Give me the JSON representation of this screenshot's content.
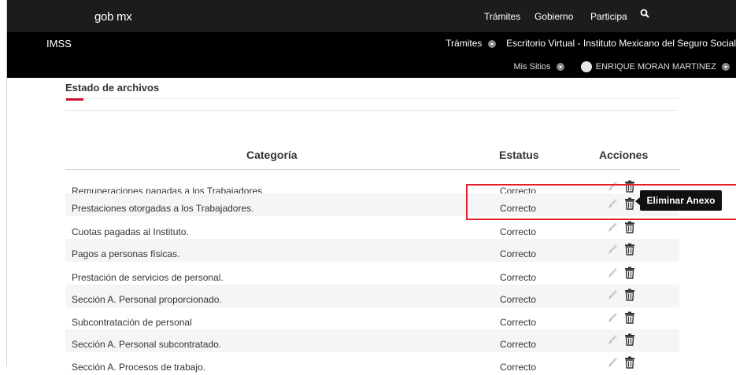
{
  "header": {
    "logo": "gob mx",
    "nav": [
      "Trámites",
      "Gobierno",
      "Participa"
    ],
    "search_icon": "search-icon"
  },
  "imss": {
    "title": "IMSS",
    "tramites": "Trámites",
    "portal": "Escritorio Virtual - Instituto Mexicano del Seguro Social",
    "mis_sitios": "Mis Sitios",
    "user": "ENRIQUE MORAN MARTINEZ"
  },
  "section": {
    "title": "Estado de archivos"
  },
  "table": {
    "headers": {
      "category": "Categoría",
      "status": "Estatus",
      "actions": "Acciones"
    },
    "rows": [
      {
        "category": "Remuneraciones pagadas a los Trabajadores.",
        "status": "Correcto"
      },
      {
        "category": "Prestaciones otorgadas a los Trabajadores.",
        "status": "Correcto"
      },
      {
        "category": "Cuotas pagadas al Instituto.",
        "status": "Correcto"
      },
      {
        "category": "Pagos a personas físicas.",
        "status": "Correcto"
      },
      {
        "category": "Prestación de servicios de personal.",
        "status": "Correcto"
      },
      {
        "category": "Sección A. Personal proporcionado.",
        "status": "Correcto"
      },
      {
        "category": "Subcontratación de personal",
        "status": "Correcto"
      },
      {
        "category": "Sección A. Personal subcontratado.",
        "status": "Correcto"
      },
      {
        "category": "Sección A. Procesos de trabajo.",
        "status": "Correcto"
      }
    ]
  },
  "tooltip": {
    "text": "Eliminar Anexo"
  },
  "colors": {
    "accent": "#c8102e",
    "highlight": "#e0202c",
    "header_bg": "#1c1c1c",
    "imss_bg": "#000000"
  }
}
